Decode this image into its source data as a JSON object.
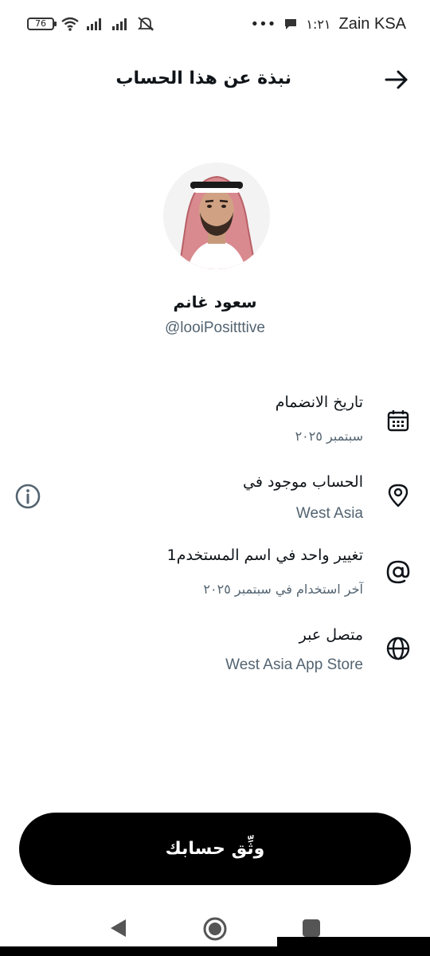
{
  "status_bar": {
    "battery_level": "76",
    "time": "١:٢١",
    "carrier": "Zain KSA",
    "dots": "•••"
  },
  "header": {
    "title": "نبذة عن هذا الحساب"
  },
  "profile": {
    "display_name": "سعود غانم",
    "handle": "@looiPositttive"
  },
  "details": {
    "joined": {
      "title": "تاريخ الانضمام",
      "value": "سبتمبر ٢٠٢٥"
    },
    "location": {
      "title": "الحساب موجود في",
      "value": "West Asia"
    },
    "username_change": {
      "title": "تغيير واحد في اسم المستخدم1",
      "value": "آخر استخدام في سبتمبر ٢٠٢٥"
    },
    "connected_via": {
      "title": "متصل عبر",
      "value": "West Asia App Store"
    }
  },
  "verify_button": {
    "label": "وثِّق حسابك"
  },
  "colors": {
    "accent": "#000000",
    "secondary_text": "#536471",
    "primary_text": "#0f1419"
  }
}
